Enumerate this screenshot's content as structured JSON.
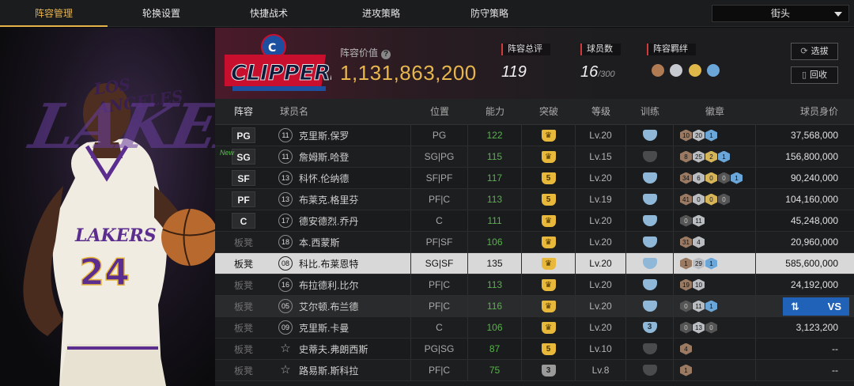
{
  "tabs": [
    "阵容管理",
    "轮换设置",
    "快捷战术",
    "进攻策略",
    "防守策略"
  ],
  "mode_selector": "街头",
  "header": {
    "team_value_label": "阵容价值",
    "team_value": "1,131,863,200",
    "overall_label": "阵容总评",
    "overall": "119",
    "players_label": "球员数",
    "players_count": "16",
    "players_max": "/300",
    "bonds_label": "阵容羁绊",
    "btn_select": "选拔",
    "btn_recycle": "回收",
    "team_logo_text": "CLIPPERS"
  },
  "columns": [
    "阵容",
    "球员名",
    "位置",
    "能力",
    "突破",
    "等级",
    "训练",
    "徽章",
    "球员身价"
  ],
  "rows": [
    {
      "slot": "PG",
      "num": "11",
      "name": "克里斯.保罗",
      "pos": "PG",
      "ovr": "122",
      "brk": "♛",
      "lvl": "Lv.20",
      "trn": "",
      "badges": [
        [
          "10",
          "br"
        ],
        [
          "20",
          "si"
        ],
        [
          "1",
          "bl"
        ]
      ],
      "salary": "37,568,000"
    },
    {
      "slot": "SG",
      "num": "11",
      "name": "詹姆斯.哈登",
      "pos": "SG|PG",
      "ovr": "115",
      "brk": "♛",
      "lvl": "Lv.15",
      "trn": "off",
      "badges": [
        [
          "8",
          "br"
        ],
        [
          "25",
          "si"
        ],
        [
          "2",
          "go"
        ],
        [
          "1",
          "bl"
        ]
      ],
      "salary": "156,800,000",
      "new": "New"
    },
    {
      "slot": "SF",
      "num": "13",
      "name": "科怀.伦纳德",
      "pos": "SF|PF",
      "ovr": "117",
      "brk": "5",
      "lvl": "Lv.20",
      "trn": "",
      "badges": [
        [
          "34",
          "br"
        ],
        [
          "6",
          "si"
        ],
        [
          "0",
          "go"
        ],
        [
          "0",
          "dk"
        ],
        [
          "1",
          "bl"
        ]
      ],
      "salary": "90,240,000"
    },
    {
      "slot": "PF",
      "num": "13",
      "name": "布莱克.格里芬",
      "pos": "PF|C",
      "ovr": "113",
      "brk": "5",
      "lvl": "Lv.19",
      "trn": "",
      "badges": [
        [
          "41",
          "br"
        ],
        [
          "0",
          "si"
        ],
        [
          "0",
          "go"
        ],
        [
          "0",
          "dk"
        ]
      ],
      "salary": "104,160,000"
    },
    {
      "slot": "C",
      "num": "17",
      "name": "德安德烈.乔丹",
      "pos": "C",
      "ovr": "111",
      "brk": "♛",
      "lvl": "Lv.20",
      "trn": "",
      "badges": [
        [
          "0",
          "dk"
        ],
        [
          "11",
          "si"
        ]
      ],
      "salary": "45,248,000"
    },
    {
      "slot": "板凳",
      "num": "18",
      "name": "本.西蒙斯",
      "pos": "PF|SF",
      "ovr": "106",
      "brk": "♛",
      "lvl": "Lv.20",
      "trn": "",
      "badges": [
        [
          "31",
          "br"
        ],
        [
          "4",
          "si"
        ]
      ],
      "salary": "20,960,000"
    },
    {
      "slot": "板凳",
      "num": "08",
      "name": "科比.布莱恩特",
      "pos": "SG|SF",
      "ovr": "135",
      "brk": "♛",
      "lvl": "Lv.20",
      "trn": "",
      "badges": [
        [
          "1",
          "br"
        ],
        [
          "29",
          "si"
        ],
        [
          "1",
          "bl"
        ]
      ],
      "salary": "585,600,000",
      "selected": true
    },
    {
      "slot": "板凳",
      "num": "16",
      "name": "布拉德利.比尔",
      "pos": "PF|C",
      "ovr": "113",
      "brk": "♛",
      "lvl": "Lv.20",
      "trn": "",
      "badges": [
        [
          "19",
          "br"
        ],
        [
          "10",
          "si"
        ]
      ],
      "salary": "24,192,000"
    },
    {
      "slot": "板凳",
      "num": "05",
      "name": "艾尔顿.布兰德",
      "pos": "PF|C",
      "ovr": "116",
      "brk": "♛",
      "lvl": "Lv.20",
      "trn": "",
      "badges": [
        [
          "0",
          "dk"
        ],
        [
          "11",
          "si"
        ],
        [
          "1",
          "bl"
        ]
      ],
      "salary": "",
      "dim": true,
      "vs": "VS"
    },
    {
      "slot": "板凳",
      "num": "09",
      "name": "克里斯.卡曼",
      "pos": "C",
      "ovr": "106",
      "brk": "♛",
      "lvl": "Lv.20",
      "trn": "3",
      "badges": [
        [
          "0",
          "dk"
        ],
        [
          "13",
          "si"
        ],
        [
          "0",
          "dk"
        ]
      ],
      "salary": "3,123,200"
    },
    {
      "slot": "板凳",
      "num": "☆",
      "name": "史蒂夫.弗朗西斯",
      "pos": "PG|SG",
      "ovr": "87",
      "brk": "5",
      "lvl": "Lv.10",
      "trn": "off",
      "badges": [
        [
          "4",
          "br"
        ]
      ],
      "salary": "--"
    },
    {
      "slot": "板凳",
      "num": "☆",
      "name": "路易斯.斯科拉",
      "pos": "PF|C",
      "ovr": "75",
      "brk": "3",
      "lvl": "Lv.8",
      "trn": "off",
      "badges": [
        [
          "1",
          "br"
        ]
      ],
      "salary": "--"
    }
  ],
  "colors": {
    "accent": "#e6b34b",
    "ovr_green": "#58b34a",
    "vs_blue": "#1f62b8"
  }
}
